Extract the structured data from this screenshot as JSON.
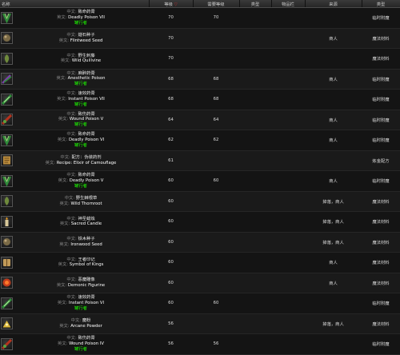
{
  "columns": [
    "名称",
    "等级",
    "需要等级",
    "类型",
    "物品栏",
    "来源",
    "类型"
  ],
  "sort_arrow": "▽",
  "labels": {
    "zh": "中文:",
    "en": "英文:"
  },
  "icon_colors": {
    "poison-green": "#2f8f3a",
    "poison-red": "#b5321d",
    "herb": "#6f8a3c",
    "seed": "#7a6a46",
    "recipe": "#b88a3c",
    "candle": "#d8c89a",
    "book": "#c19a58",
    "figurine": "#c43c1c",
    "powder": "#d9b53a"
  },
  "items": [
    {
      "icon": "deadly-poison-icon",
      "color": "poison-green",
      "zh": "致命药膏",
      "en": "Deadly Poison VII",
      "note": "罐行者",
      "level": "70",
      "req": "70",
      "type": "",
      "slot": "",
      "source": "",
      "category": "临时附魔"
    },
    {
      "icon": "seed-icon",
      "color": "seed",
      "zh": "燧石种子",
      "en": "Flintweed Seed",
      "note": "",
      "level": "70",
      "req": "",
      "type": "",
      "slot": "",
      "source": "商人",
      "category": "魔法材料"
    },
    {
      "icon": "herb-icon",
      "color": "herb",
      "zh": "野生刺藤",
      "en": "Wild Quillvine",
      "note": "",
      "level": "70",
      "req": "",
      "type": "",
      "slot": "",
      "source": "",
      "category": "魔法材料"
    },
    {
      "icon": "anesthetic-poison-icon",
      "color": "poison-green",
      "zh": "麻醉药膏",
      "en": "Anesthetic Poison",
      "note": "罐行者",
      "level": "68",
      "req": "68",
      "type": "",
      "slot": "",
      "source": "商人",
      "category": "临时附魔"
    },
    {
      "icon": "instant-poison-icon",
      "color": "poison-green",
      "zh": "速效药膏",
      "en": "Instant Poison VII",
      "note": "罐行者",
      "level": "68",
      "req": "68",
      "type": "",
      "slot": "",
      "source": "",
      "category": "临时附魔"
    },
    {
      "icon": "wound-poison-icon",
      "color": "poison-red",
      "zh": "致伤药膏",
      "en": "Wound Poison V",
      "note": "罐行者",
      "level": "64",
      "req": "64",
      "type": "",
      "slot": "",
      "source": "商人",
      "category": "临时附魔"
    },
    {
      "icon": "deadly-poison-icon",
      "color": "poison-green",
      "zh": "致命药膏",
      "en": "Deadly Poison VI",
      "note": "罐行者",
      "level": "62",
      "req": "62",
      "type": "",
      "slot": "",
      "source": "商人",
      "category": "临时附魔"
    },
    {
      "icon": "recipe-icon",
      "color": "recipe",
      "zh": "配方：伪装药剂",
      "en": "Recipe: Elixir of Camouflage",
      "note": "",
      "level": "61",
      "req": "",
      "type": "",
      "slot": "",
      "source": "",
      "category": "炼金配方"
    },
    {
      "icon": "deadly-poison-icon",
      "color": "poison-green",
      "zh": "致命药膏",
      "en": "Deadly Poison V",
      "note": "罐行者",
      "level": "60",
      "req": "60",
      "type": "",
      "slot": "",
      "source": "商人",
      "category": "临时附魔"
    },
    {
      "icon": "herb-icon",
      "color": "herb",
      "zh": "野生棘根草",
      "en": "Wild Thornroot",
      "note": "",
      "level": "60",
      "req": "",
      "type": "",
      "slot": "",
      "source": "掉落，商人",
      "category": "魔法材料"
    },
    {
      "icon": "candle-icon",
      "color": "candle",
      "zh": "神圣蜡烛",
      "en": "Sacred Candle",
      "note": "",
      "level": "60",
      "req": "",
      "type": "",
      "slot": "",
      "source": "掉落，商人",
      "category": "魔法材料"
    },
    {
      "icon": "seed-icon",
      "color": "seed",
      "zh": "铁木种子",
      "en": "Ironwood Seed",
      "note": "",
      "level": "60",
      "req": "",
      "type": "",
      "slot": "",
      "source": "掉落，商人",
      "category": "魔法材料"
    },
    {
      "icon": "book-icon",
      "color": "book",
      "zh": "王者印记",
      "en": "Symbol of Kings",
      "note": "",
      "level": "60",
      "req": "",
      "type": "",
      "slot": "",
      "source": "商人",
      "category": "魔法材料"
    },
    {
      "icon": "figurine-icon",
      "color": "figurine",
      "zh": "恶魔雕像",
      "en": "Demonic Figurine",
      "note": "",
      "level": "60",
      "req": "",
      "type": "",
      "slot": "",
      "source": "商人",
      "category": "魔法材料"
    },
    {
      "icon": "instant-poison-icon",
      "color": "poison-green",
      "zh": "速效药膏",
      "en": "Instant Poison VI",
      "note": "罐行者",
      "level": "60",
      "req": "60",
      "type": "",
      "slot": "",
      "source": "",
      "category": "临时附魔"
    },
    {
      "icon": "powder-icon",
      "color": "powder",
      "zh": "魔粉",
      "en": "Arcane Powder",
      "note": "",
      "level": "56",
      "req": "",
      "type": "",
      "slot": "",
      "source": "掉落，商人",
      "category": "魔法材料"
    },
    {
      "icon": "wound-poison-icon",
      "color": "poison-red",
      "zh": "致伤药膏",
      "en": "Wound Poison IV",
      "note": "罐行者",
      "level": "56",
      "req": "56",
      "type": "",
      "slot": "",
      "source": "",
      "category": "临时附魔"
    }
  ]
}
